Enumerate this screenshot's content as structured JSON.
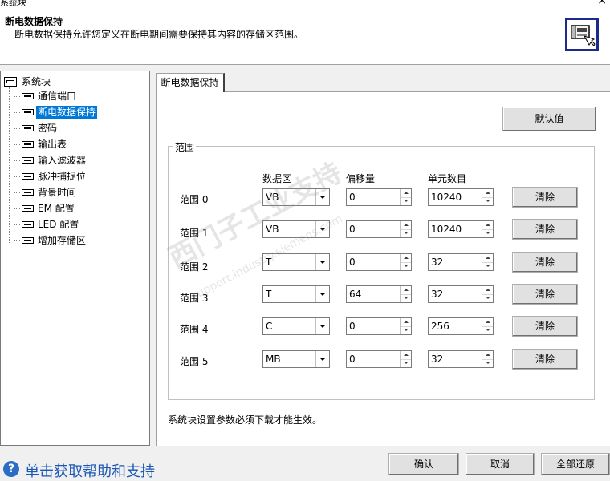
{
  "window": {
    "title": "系统块",
    "close_glyph": "×"
  },
  "header": {
    "title": "断电数据保持",
    "description": "断电数据保持允许您定义在断电期间需要保持其内容的存储区范围。",
    "icon": "retentive-data-icon"
  },
  "tree": {
    "root": "系统块",
    "items": [
      "通信端口",
      "断电数据保持",
      "密码",
      "输出表",
      "输入滤波器",
      "脉冲捕捉位",
      "背景时间",
      "EM 配置",
      "LED 配置",
      "增加存储区"
    ],
    "selected_index": 1
  },
  "tab": {
    "label": "断电数据保持"
  },
  "default_button": "默认值",
  "group": {
    "caption": "范围",
    "headers": {
      "area": "数据区",
      "offset": "偏移量",
      "count": "单元数目"
    },
    "rows": [
      {
        "label": "范围 0",
        "area": "VB",
        "offset": "0",
        "count": "10240",
        "clear": "清除"
      },
      {
        "label": "范围 1",
        "area": "VB",
        "offset": "0",
        "count": "10240",
        "clear": "清除"
      },
      {
        "label": "范围 2",
        "area": "T",
        "offset": "0",
        "count": "32",
        "clear": "清除"
      },
      {
        "label": "范围 3",
        "area": "T",
        "offset": "64",
        "count": "32",
        "clear": "清除"
      },
      {
        "label": "范围 4",
        "area": "C",
        "offset": "0",
        "count": "256",
        "clear": "清除"
      },
      {
        "label": "范围 5",
        "area": "MB",
        "offset": "0",
        "count": "32",
        "clear": "清除"
      }
    ]
  },
  "notice": "系统块设置参数必须下载才能生效。",
  "footer": {
    "help_icon": "?",
    "help_link": "单击获取帮助和支持",
    "ok": "确认",
    "cancel": "取消",
    "restore_all": "全部还原"
  },
  "watermark": {
    "text": "西门子工业支持",
    "url": "support.industry.siemens.com"
  }
}
